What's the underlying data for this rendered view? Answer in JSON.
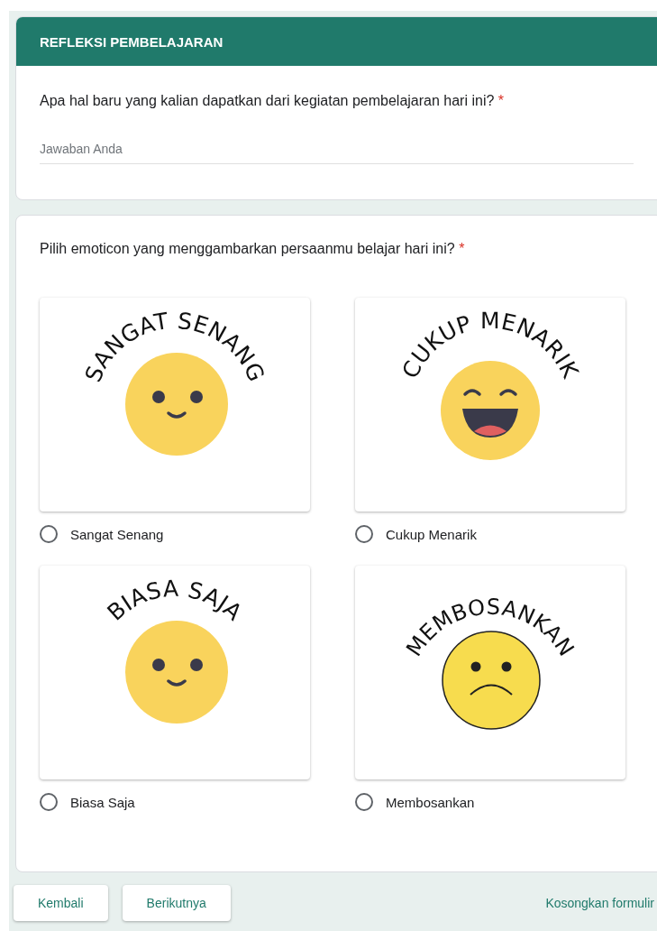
{
  "section_header": {
    "title": "REFLEKSI PEMBELAJARAN"
  },
  "question_1": {
    "text": "Apa hal baru yang kalian dapatkan dari kegiatan pembelajaran hari ini?",
    "required_mark": "*",
    "answer": {
      "placeholder": "Jawaban Anda"
    }
  },
  "question_2": {
    "text": "Pilih emoticon yang menggambarkan persaanmu belajar hari ini?",
    "required_mark": "*",
    "options": [
      {
        "label": "Sangat Senang",
        "selected": false,
        "image_caption": "SANGAT SENANG",
        "kind": "smile"
      },
      {
        "label": "Cukup Menarik",
        "selected": false,
        "image_caption": "CUKUP MENARIK",
        "kind": "laugh"
      },
      {
        "label": "Biasa Saja",
        "selected": false,
        "image_caption": "BIASA SAJA",
        "kind": "smile"
      },
      {
        "label": "Membosankan",
        "selected": false,
        "image_caption": "MEMBOSANKAN",
        "kind": "sad"
      }
    ]
  },
  "footer": {
    "buttons": [
      "Kembali",
      "Berikutnya"
    ],
    "clear_link": "Kosongkan formulir"
  }
}
